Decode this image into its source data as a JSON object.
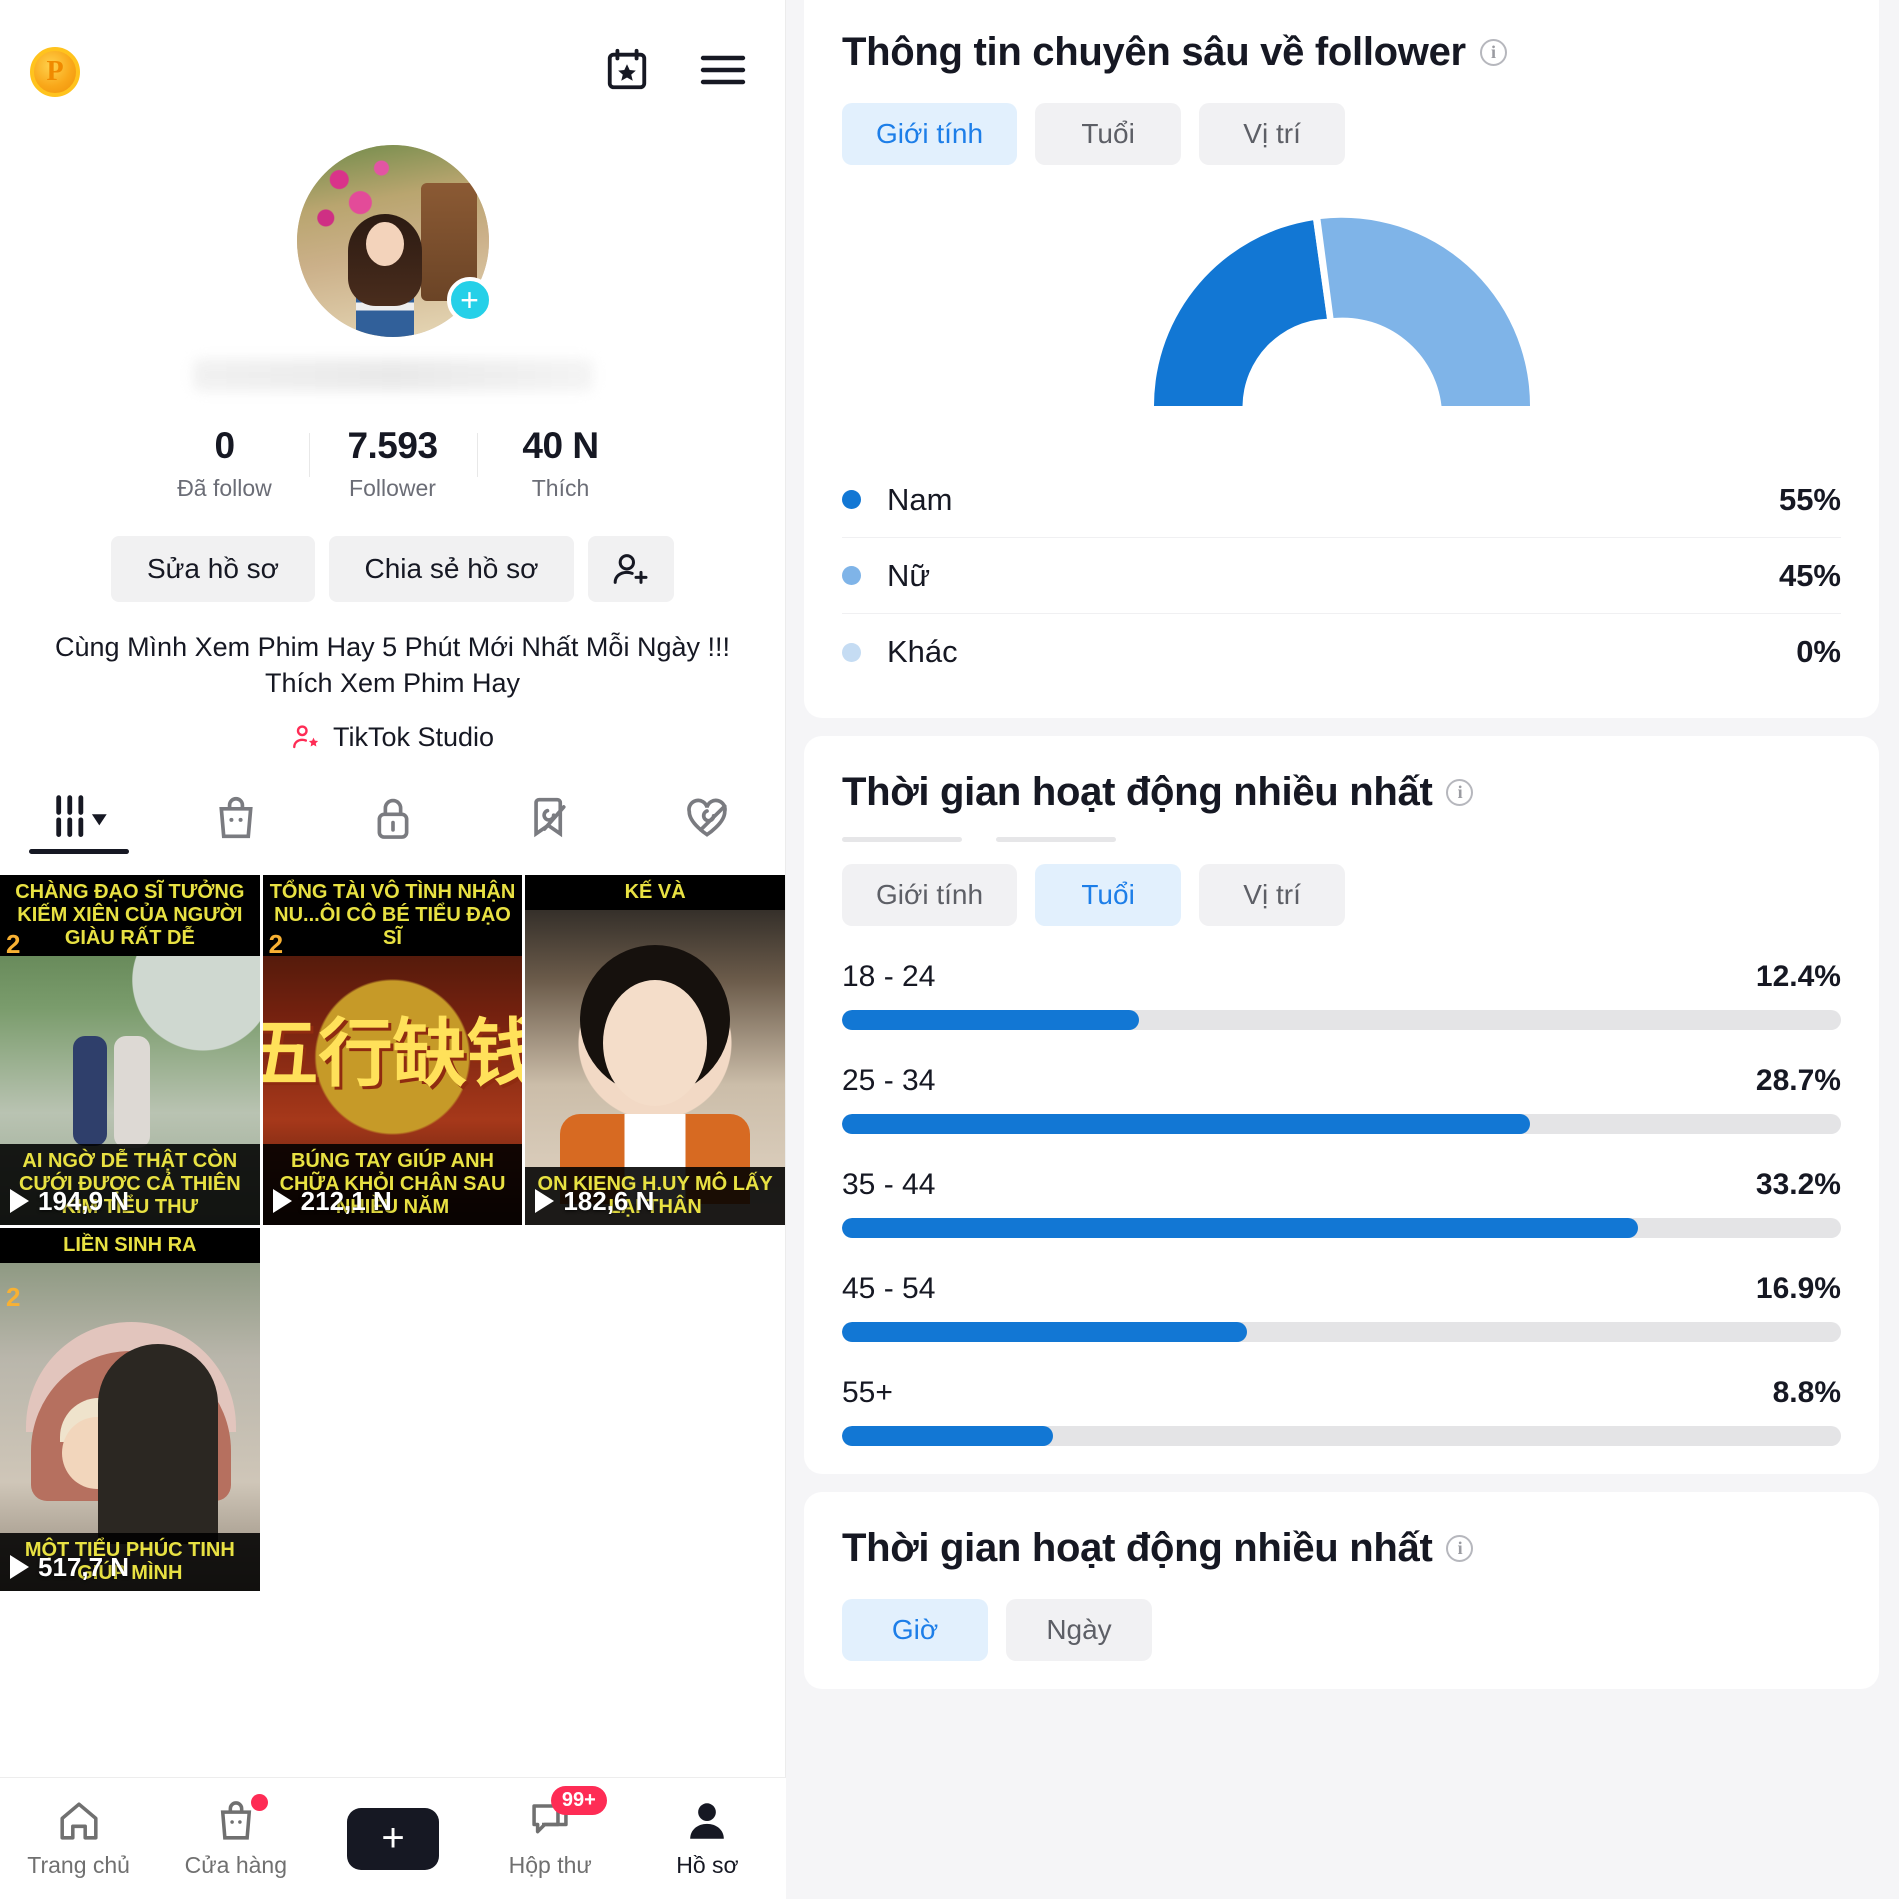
{
  "profile": {
    "coin_badge": "P",
    "stats": [
      {
        "value": "0",
        "label": "Đã follow"
      },
      {
        "value": "7.593",
        "label": "Follower"
      },
      {
        "value": "40 N",
        "label": "Thích"
      }
    ],
    "buttons": {
      "edit": "Sửa hồ sơ",
      "share": "Chia sẻ hồ sơ",
      "add_friend_icon": "add-user-icon"
    },
    "bio": "Cùng Mình Xem Phim Hay 5 Phút Mới Nhất Mỗi Ngày !!! Thích Xem Phim Hay",
    "studio_label": "TikTok Studio",
    "tabs": [
      {
        "name": "videos-tab",
        "icon": "grid-dropdown-icon",
        "active": true
      },
      {
        "name": "shop-tab",
        "icon": "shopping-bag-icon",
        "active": false
      },
      {
        "name": "private-tab",
        "icon": "lock-icon",
        "active": false
      },
      {
        "name": "unsaved-tab",
        "icon": "bookmark-slash-icon",
        "active": false
      },
      {
        "name": "hidden-likes-tab",
        "icon": "heart-slash-icon",
        "active": false
      }
    ],
    "videos": [
      {
        "top_caption": "CHÀNG ĐẠO SĨ TƯỞNG KIẾM XIÊN CỦA NGƯỜI GIÀU RẤT DỄ",
        "bottom_caption": "AI NGỜ DỄ THẬT CÒN CƯỚI ĐƯỢC CẢ THIÊN KIM TIỂU THƯ",
        "views": "194,9 N",
        "corner": "2"
      },
      {
        "top_caption": "TỔNG TÀI VÔ TÌNH NHẬN NU...ÔI CÔ BÉ TIỂU ĐẠO SĨ",
        "bottom_caption": "BÚNG TAY GIÚP ANH CHỮA KHỎI CHÂN SAU NHIỀU NĂM",
        "views": "212,1 N",
        "corner": "2"
      },
      {
        "top_caption": "KẾ VÀ",
        "bottom_caption": "ON KIENG H.UY MÔ LẤY LẠI THÂN",
        "views": "182,6 N",
        "corner": ""
      },
      {
        "top_caption": "LIỀN SINH RA",
        "bottom_caption": "MỘT TIỂU PHÚC TINH GIÚP MÌNH",
        "views": "517,7 N",
        "corner": "2"
      }
    ],
    "bottom_nav": [
      {
        "label": "Trang chủ",
        "icon": "home-icon",
        "active": false,
        "badge": ""
      },
      {
        "label": "Cửa hàng",
        "icon": "shop-bag-icon",
        "active": false,
        "badge": "dot"
      },
      {
        "label": "",
        "icon": "create-plus-icon",
        "active": false,
        "badge": ""
      },
      {
        "label": "Hộp thư",
        "icon": "inbox-icon",
        "active": false,
        "badge": "99+"
      },
      {
        "label": "Hồ sơ",
        "icon": "person-icon",
        "active": true,
        "badge": ""
      }
    ]
  },
  "analytics": {
    "follower_card": {
      "title": "Thông tin chuyên sâu về follower",
      "segments": [
        {
          "label": "Giới tính",
          "active": true
        },
        {
          "label": "Tuổi",
          "active": false
        },
        {
          "label": "Vị trí",
          "active": false
        }
      ]
    },
    "activity_card": {
      "title": "Thời gian hoạt động nhiều nhất",
      "segments": [
        {
          "label": "Giới tính",
          "active": false
        },
        {
          "label": "Tuổi",
          "active": true
        },
        {
          "label": "Vị trí",
          "active": false
        }
      ]
    },
    "hours_card": {
      "title": "Thời gian hoạt động nhiều nhất",
      "segments": [
        {
          "label": "Giờ",
          "active": true
        },
        {
          "label": "Ngày",
          "active": false
        }
      ]
    }
  },
  "colors": {
    "primary_blue": "#1277d4",
    "light_blue": "#7fb4e8",
    "pale_blue": "#c5dcf3",
    "accent_cyan": "#25f4ee",
    "accent_pink": "#fe2c55",
    "track_gray": "#e4e4e6"
  },
  "chart_data": [
    {
      "type": "pie",
      "title": "Thông tin chuyên sâu về follower",
      "subtitle": "Giới tính",
      "shape": "half-donut",
      "legend_position": "below",
      "categories": [
        "Nam",
        "Nữ",
        "Khác"
      ],
      "values": [
        55,
        45,
        0
      ],
      "labels": [
        "55%",
        "45%",
        "0%"
      ],
      "colors": [
        "#1277d4",
        "#7fb4e8",
        "#c5dcf3"
      ]
    },
    {
      "type": "bar",
      "orientation": "horizontal",
      "title": "Thời gian hoạt động nhiều nhất",
      "subtitle": "Tuổi",
      "categories": [
        "18 - 24",
        "25 - 34",
        "35 - 44",
        "45 - 54",
        "55+"
      ],
      "values": [
        12.4,
        28.7,
        33.2,
        16.9,
        8.8
      ],
      "labels": [
        "12.4%",
        "28.7%",
        "33.2%",
        "16.9%",
        "8.8%"
      ],
      "xlabel": "",
      "ylabel": "",
      "xlim": [
        0,
        100
      ],
      "grid": false,
      "bar_color": "#1277d4",
      "track_color": "#e4e4e6"
    }
  ]
}
